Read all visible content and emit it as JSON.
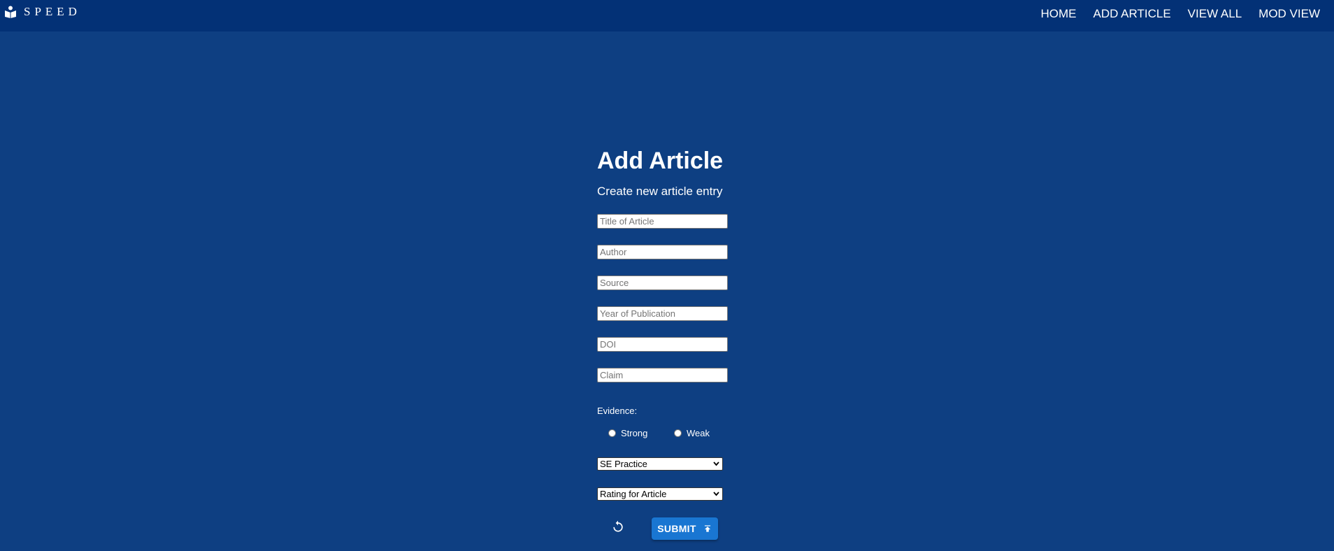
{
  "brand": {
    "name": "SPEED",
    "logo_icon": "open-book-icon"
  },
  "nav": {
    "items": [
      {
        "label": "HOME"
      },
      {
        "label": "ADD ARTICLE"
      },
      {
        "label": "VIEW ALL"
      },
      {
        "label": "MOD VIEW"
      }
    ]
  },
  "form": {
    "title": "Add Article",
    "subtitle": "Create new article entry",
    "fields": [
      {
        "placeholder": "Title of Article",
        "value": ""
      },
      {
        "placeholder": "Author",
        "value": ""
      },
      {
        "placeholder": "Source",
        "value": ""
      },
      {
        "placeholder": "Year of Publication",
        "value": ""
      },
      {
        "placeholder": "DOI",
        "value": ""
      },
      {
        "placeholder": "Claim",
        "value": ""
      }
    ],
    "evidence": {
      "label": "Evidence:",
      "options": [
        {
          "label": "Strong",
          "selected": false
        },
        {
          "label": "Weak",
          "selected": false
        }
      ]
    },
    "practice_select": {
      "selected": "SE Practice"
    },
    "rating_select": {
      "selected": "Rating for Article"
    },
    "reset_icon": "reset-icon",
    "submit_label": "SUBMIT",
    "submit_icon": "upload-icon"
  },
  "colors": {
    "navbar": "#033176",
    "background": "#0e3f82",
    "submit_button": "#1976d2"
  }
}
